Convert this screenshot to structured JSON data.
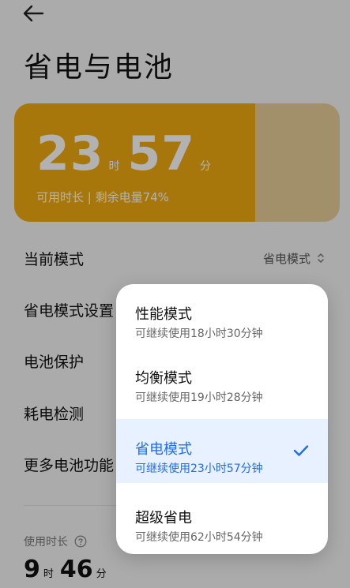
{
  "header": {
    "title": "省电与电池"
  },
  "battery_card": {
    "hours": "23",
    "hour_unit": "时",
    "minutes": "57",
    "minute_unit": "分",
    "subtitle": "可用时长 | 剩余电量74%",
    "level_fraction": 0.74
  },
  "rows": {
    "current_mode_label": "当前模式",
    "current_mode_value": "省电模式",
    "power_saving_settings": "省电模式设置",
    "battery_protection": "电池保护",
    "power_consumption_check": "耗电检测",
    "more_battery_features": "更多电池功能"
  },
  "usage": {
    "label": "使用时长",
    "hours": "9",
    "hour_unit": "时",
    "minutes": "46",
    "minute_unit": "分"
  },
  "mode_menu": {
    "options": [
      {
        "title": "性能模式",
        "subtitle": "可继续使用18小时30分钟",
        "selected": false
      },
      {
        "title": "均衡模式",
        "subtitle": "可继续使用19小时28分钟",
        "selected": false
      },
      {
        "title": "省电模式",
        "subtitle": "可继续使用23小时57分钟",
        "selected": true
      },
      {
        "title": "超级省电",
        "subtitle": "可继续使用62小时54分钟",
        "selected": false
      }
    ]
  },
  "colors": {
    "battery_fill": "#f0ab11",
    "battery_empty": "#e8cf9a",
    "accent": "#1e6cf0",
    "selected_bg": "#e8f1ff"
  },
  "icons": {
    "back": "back-arrow-icon",
    "chevron": "chevron-up-down-icon",
    "help": "question-circle-icon",
    "check": "checkmark-icon"
  }
}
